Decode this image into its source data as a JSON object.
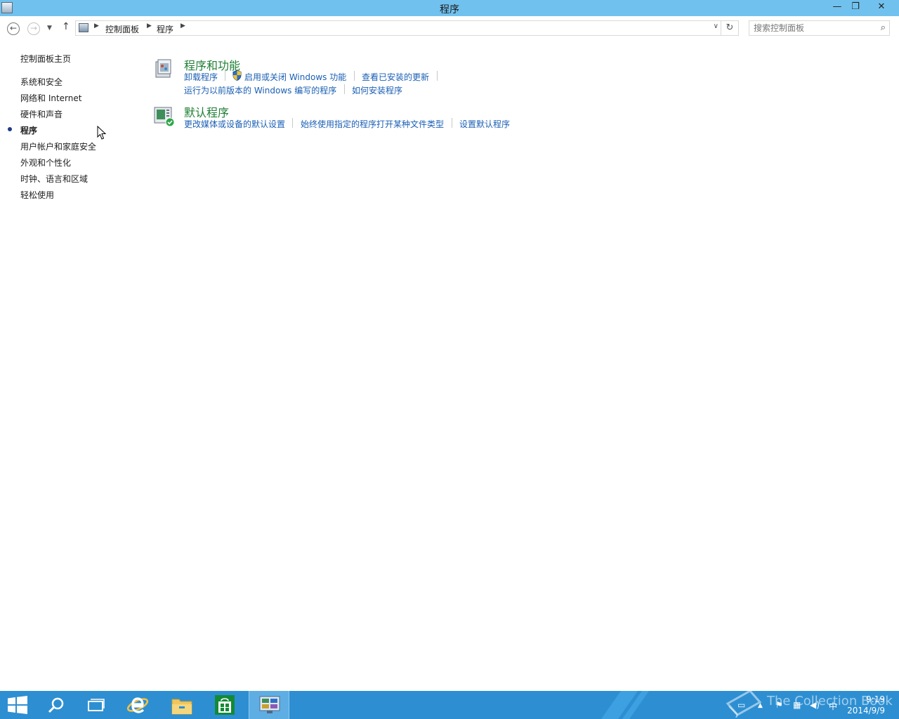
{
  "window": {
    "title": "程序"
  },
  "address": {
    "crumbs": [
      "控制面板",
      "程序"
    ]
  },
  "search": {
    "placeholder": "搜索控制面板"
  },
  "sidebar": {
    "home": "控制面板主页",
    "items": [
      {
        "label": "系统和安全",
        "active": false
      },
      {
        "label": "网络和 Internet",
        "active": false
      },
      {
        "label": "硬件和声音",
        "active": false
      },
      {
        "label": "程序",
        "active": true
      },
      {
        "label": "用户帐户和家庭安全",
        "active": false
      },
      {
        "label": "外观和个性化",
        "active": false
      },
      {
        "label": "时钟、语言和区域",
        "active": false
      },
      {
        "label": "轻松使用",
        "active": false
      }
    ]
  },
  "categories": [
    {
      "title": "程序和功能",
      "links": [
        "卸载程序",
        "启用或关闭 Windows 功能",
        "查看已安装的更新",
        "运行为以前版本的 Windows 编写的程序",
        "如何安装程序"
      ]
    },
    {
      "title": "默认程序",
      "links": [
        "更改媒体或设备的默认设置",
        "始终使用指定的程序打开某种文件类型",
        "设置默认程序"
      ]
    }
  ],
  "taskbar": {
    "apps": [
      "start-icon",
      "search-icon",
      "task-view-icon",
      "internet-explorer-icon",
      "file-explorer-icon",
      "store-icon",
      "control-panel-icon"
    ],
    "clock_time": "9:19",
    "clock_date": "2014/9/9",
    "ime": "中",
    "watermark": "The Collection Book"
  },
  "colors": {
    "titlebar": "#71c1ee",
    "taskbar": "#2d8fd2",
    "category_title": "#1e7e34",
    "link": "#1a5fb4"
  }
}
